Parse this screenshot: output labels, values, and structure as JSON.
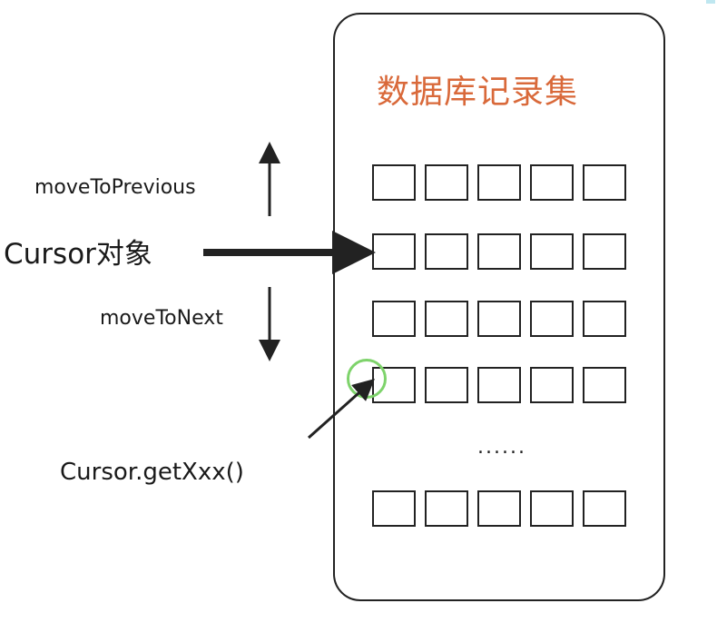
{
  "diagram": {
    "title": "数据库记录集",
    "labels": {
      "move_previous": "moveToPrevious",
      "cursor_object": "Cursor对象",
      "move_next": "moveToNext",
      "get_method": "Cursor.getXxx()"
    },
    "ellipsis": "......",
    "record_rows": 5,
    "cells_per_row": 5,
    "colors": {
      "title": "#d9693a",
      "stroke": "#222222",
      "highlight_circle": "#7ed36b"
    }
  }
}
